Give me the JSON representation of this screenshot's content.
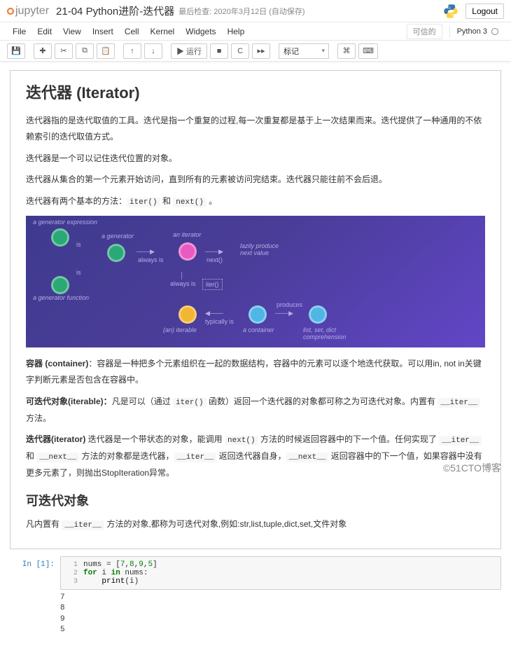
{
  "header": {
    "logo": "jupyter",
    "nbname": "21-04 Python进阶-迭代器",
    "save": "最后检查: 2020年3月12日  (自动保存)",
    "logout": "Logout"
  },
  "menubar": {
    "items": [
      "File",
      "Edit",
      "View",
      "Insert",
      "Cell",
      "Kernel",
      "Widgets",
      "Help"
    ],
    "trusted": "可信的",
    "kernel": "Python 3"
  },
  "toolbar": {
    "save": "💾",
    "add": "✚",
    "cut": "✂",
    "copy": "⧉",
    "paste": "📋",
    "up": "↑",
    "down": "↓",
    "run": "▶ 运行",
    "stop": "■",
    "restart": "C",
    "fwd": "▸▸",
    "celltype": "标记",
    "cmd": "⌘",
    "keyboard": "⌨"
  },
  "content": {
    "h2": "迭代器   (Iterator)",
    "p1": "迭代器指的是迭代取值的工具。迭代是指一个重复的过程,每一次重复都是基于上一次结果而来。迭代提供了一种通用的不依赖索引的迭代取值方式。",
    "p2": "迭代器是一个可以记住迭代位置的对象。",
    "p3": "迭代器从集合的第一个元素开始访问，直到所有的元素被访问完结束。迭代器只能往前不会后退。",
    "p4_a": "迭代器有两个基本的方法：",
    "p4_c1": "iter()",
    "p4_b": " 和 ",
    "p4_c2": "next()",
    "p4_c": " 。",
    "p5_a": "容器   (container)",
    "p5_b": "：容器是一种把多个元素组织在一起的数据结构，容器中的元素可以逐个地迭代获取。可以用in, not in关键字判断元素是否包含在容器中。",
    "p6_a": "可迭代对象(iterable)：",
    "p6_b": "凡是可以（通过 ",
    "p6_c1": "iter()",
    "p6_c": " 函数）返回一个迭代器的对象都可称之为可迭代对象。内置有 ",
    "p6_c2": "__iter__",
    "p6_d": " 方法。",
    "p7_a": "迭代器(iterator)",
    "p7_b": "  迭代器是一个带状态的对象，能调用 ",
    "p7_c1": "next()",
    "p7_c": " 方法的时候返回容器中的下一个值。任何实现了 ",
    "p7_c2": "__iter__",
    "p7_d": " 和 ",
    "p7_c3": "__next__",
    "p7_e": " 方法的对象都是迭代器，",
    "p7_c4": "__iter__",
    "p7_f": " 返回迭代器自身，",
    "p7_c5": "__next__",
    "p7_g": " 返回容器中的下一个值，如果容器中没有更多元素了，则抛出StopIteration异常。",
    "h3": "可迭代对象",
    "p8_a": "凡内置有 ",
    "p8_c1": "__iter__",
    "p8_b": " 方法的对象,都称为可迭代对象,例如:str,list,tuple,dict,set,文件对象"
  },
  "diagram": {
    "l_genexp": "a generator expression",
    "l_gen": "a generator",
    "l_iter": "an iterator",
    "l_lazy": "lazily produce\nnext value",
    "l_genfn": "a generator function",
    "l_iterable": "(an) iterable",
    "l_cont": "a container",
    "l_comp": "list, set, dict\ncomprehension",
    "t_is": "is",
    "t_always": "always is",
    "t_next": "next()",
    "t_iter": "iter()",
    "t_typ": "typically is",
    "t_prod": "produces"
  },
  "code": {
    "prompt": "In  [1]:",
    "l1": "nums = [7,8,9,5]",
    "l2": "for i in nums:",
    "l3": "    print(i)",
    "output": "7\n8\n9\n5"
  },
  "watermark": "©51CTO博客"
}
